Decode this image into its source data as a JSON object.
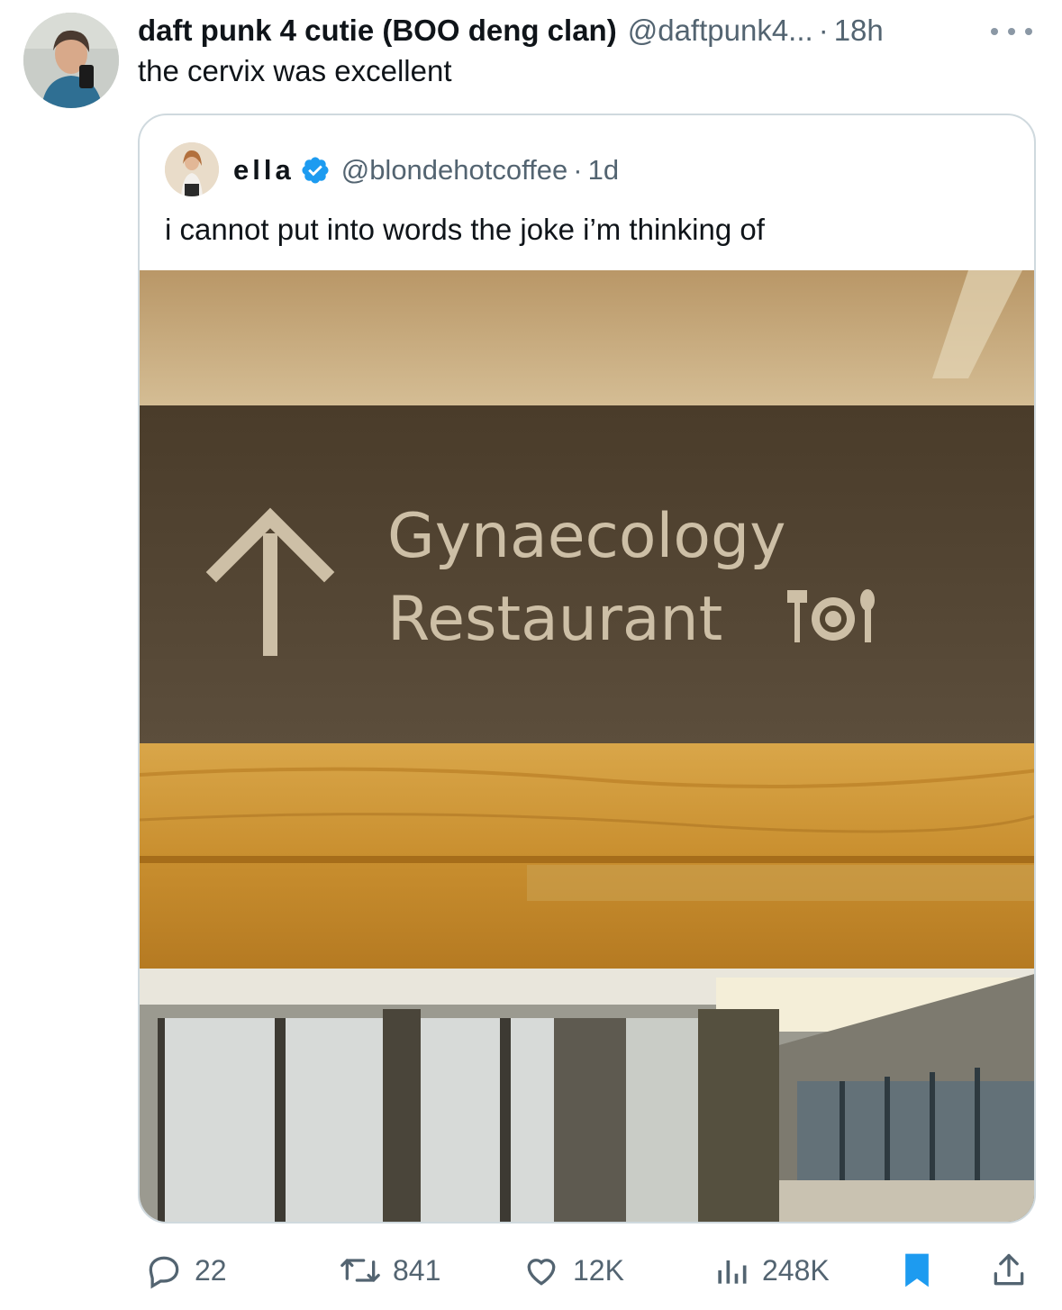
{
  "tweet": {
    "author_name": "daft punk 4 cutie (BOO deng clan)",
    "author_handle": "@daftpunk4...",
    "separator": "·",
    "time": "18h",
    "text": "the cervix was excellent",
    "more_icon": "ellipsis-icon"
  },
  "quoted": {
    "author_name": "ella",
    "verified_icon": "verified-badge-icon",
    "author_handle": "@blondehotcoffee",
    "separator": "·",
    "time": "1d",
    "text": "i cannot put into words the joke i’m thinking of",
    "image": {
      "sign_line1": "Gynaecology",
      "sign_line2": "Restaurant",
      "sign_icon": "restaurant-icon",
      "arrow_icon": "up-arrow-icon"
    }
  },
  "actions": {
    "replies": "22",
    "reposts": "841",
    "likes": "12K",
    "views": "248K",
    "icons": [
      "reply-icon",
      "repost-icon",
      "like-icon",
      "views-icon",
      "bookmark-icon",
      "share-icon"
    ]
  },
  "colors": {
    "text_primary": "#0f1419",
    "text_secondary": "#536471",
    "border": "#cfd9de",
    "verified": "#1d9bf0",
    "bookmark": "#1d9bf0"
  }
}
